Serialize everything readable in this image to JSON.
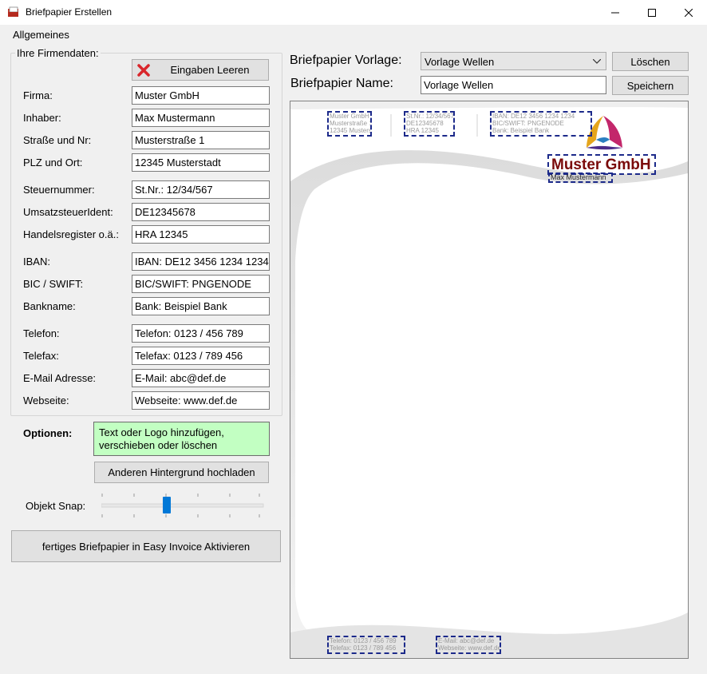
{
  "window": {
    "title": "Briefpapier Erstellen"
  },
  "menu": {
    "items": [
      "Allgemeines"
    ]
  },
  "company": {
    "group_label": "Ihre Firmendaten:",
    "clear_button": "Eingaben Leeren",
    "fields": [
      {
        "label": "Firma:",
        "value": "Muster GmbH"
      },
      {
        "label": "Inhaber:",
        "value": "Max Mustermann"
      },
      {
        "label": "Straße und Nr:",
        "value": "Musterstraße 1"
      },
      {
        "label": "PLZ und Ort:",
        "value": "12345 Musterstadt"
      },
      {
        "label": "Steuernummer:",
        "value": "St.Nr.: 12/34/567"
      },
      {
        "label": "UmsatzsteuerIdent:",
        "value": "DE12345678"
      },
      {
        "label": "Handelsregister o.ä.:",
        "value": "HRA 12345"
      },
      {
        "label": "IBAN:",
        "value": "IBAN: DE12 3456 1234 1234"
      },
      {
        "label": "BIC  / SWIFT:",
        "value": "BIC/SWIFT: PNGENODE"
      },
      {
        "label": "Bankname:",
        "value": "Bank: Beispiel Bank"
      },
      {
        "label": "Telefon:",
        "value": "Telefon: 0123 / 456 789"
      },
      {
        "label": "Telefax:",
        "value": "Telefax: 0123 / 789 456"
      },
      {
        "label": "E-Mail Adresse:",
        "value": "E-Mail: abc@def.de"
      },
      {
        "label": "Webseite:",
        "value": "Webseite: www.def.de"
      }
    ]
  },
  "options": {
    "label": "Optionen:",
    "info_line1": "Text oder Logo hinzufügen,",
    "info_line2": "verschieben oder löschen",
    "upload_button": "Anderen Hintergrund hochladen",
    "snap_label": "Objekt Snap:",
    "activate_button": "fertiges Briefpapier in Easy Invoice Aktivieren"
  },
  "template": {
    "vorlage_label": "Briefpapier Vorlage:",
    "vorlage_value": "Vorlage Wellen",
    "delete_button": "Löschen",
    "name_label": "Briefpapier Name:",
    "name_value": "Vorlage Wellen",
    "save_button": "Speichern"
  },
  "preview": {
    "col1": [
      "Muster GmbH",
      "Musterstraße 1",
      "12345 Musterstadt"
    ],
    "col2": [
      "St.Nr.: 12/34/567",
      "DE12345678",
      "HRA 12345"
    ],
    "col3": [
      "IBAN: DE12 3456 1234 1234",
      "BIC/SWIFT: PNGENODE",
      "Bank: Beispiel Bank"
    ],
    "company_name": "Muster GmbH",
    "owner": "Max Mustermann",
    "footer1": [
      "Telefon: 0123 / 456 789",
      "Telefax: 0123 / 789 456"
    ],
    "footer2": [
      "E-Mail: abc@def.de",
      "Webseite: www.def.de"
    ]
  },
  "colors": {
    "accent": "#0078d7",
    "company_name": "#7a0a0a",
    "option_bg": "#c2ffc2"
  },
  "icons": {
    "clear": "red-x-icon",
    "app": "briefpapier-icon"
  }
}
